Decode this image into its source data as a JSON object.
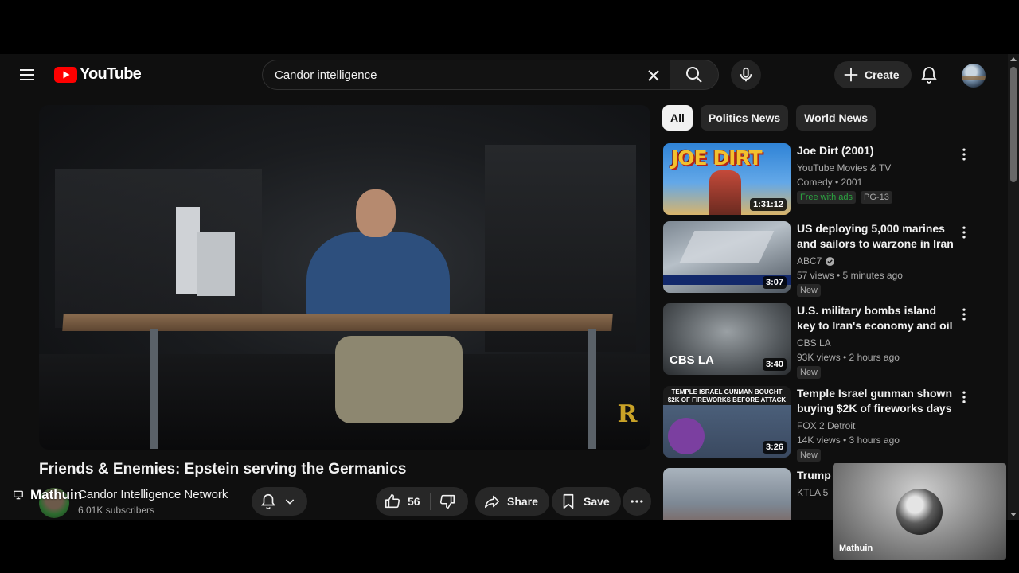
{
  "header": {
    "logo_text": "YouTube",
    "search": {
      "value": "Candor intelligence",
      "placeholder": "Search"
    },
    "create_label": "Create"
  },
  "video": {
    "title": "Friends & Enemies: Epstein serving the Germanics",
    "channel_name": "Candor Intelligence Network",
    "subscribers": "6.01K subscribers",
    "likes": "56",
    "share_label": "Share",
    "save_label": "Save",
    "watermark": "R"
  },
  "overlay_name": "Mathuin",
  "chips": [
    {
      "label": "All",
      "active": true
    },
    {
      "label": "Politics News",
      "active": false
    },
    {
      "label": "World News",
      "active": false
    }
  ],
  "recommendations": [
    {
      "title": "Joe Dirt (2001)",
      "channel": "YouTube Movies & TV",
      "meta": "Comedy • 2001",
      "duration": "1:31:12",
      "badges": [
        "Free with ads",
        "PG-13"
      ],
      "thumb_text": "JOE DIRT"
    },
    {
      "title": "US deploying 5,000 marines and sailors to warzone in Iran as ...",
      "channel": "ABC7",
      "verified": true,
      "meta": "57 views • 5 minutes ago",
      "duration": "3:07",
      "badges": [
        "New"
      ]
    },
    {
      "title": "U.S. military bombs island key to Iran's economy and oil ...",
      "channel": "CBS LA",
      "meta": "93K views • 2 hours ago",
      "duration": "3:40",
      "badges": [
        "New"
      ],
      "thumb_text": "CBS LA"
    },
    {
      "title": "Temple Israel gunman shown buying $2K of fireworks days ...",
      "channel": "FOX 2 Detroit",
      "meta": "14K views • 3 hours ago",
      "duration": "3:26",
      "badges": [
        "New"
      ],
      "thumb_text": "TEMPLE ISRAEL GUNMAN BOUGHT $2K OF FIREWORKS BEFORE ATTACK"
    },
    {
      "title": "Trump s... military ...",
      "channel": "KTLA 5",
      "meta": "",
      "duration": "",
      "badges": []
    }
  ],
  "webcam": {
    "name": "Mathuin"
  },
  "colors": {
    "accent": "#ff0000",
    "background": "#0f0f0f",
    "surface": "#272727",
    "free_badge": "#2ba640"
  }
}
